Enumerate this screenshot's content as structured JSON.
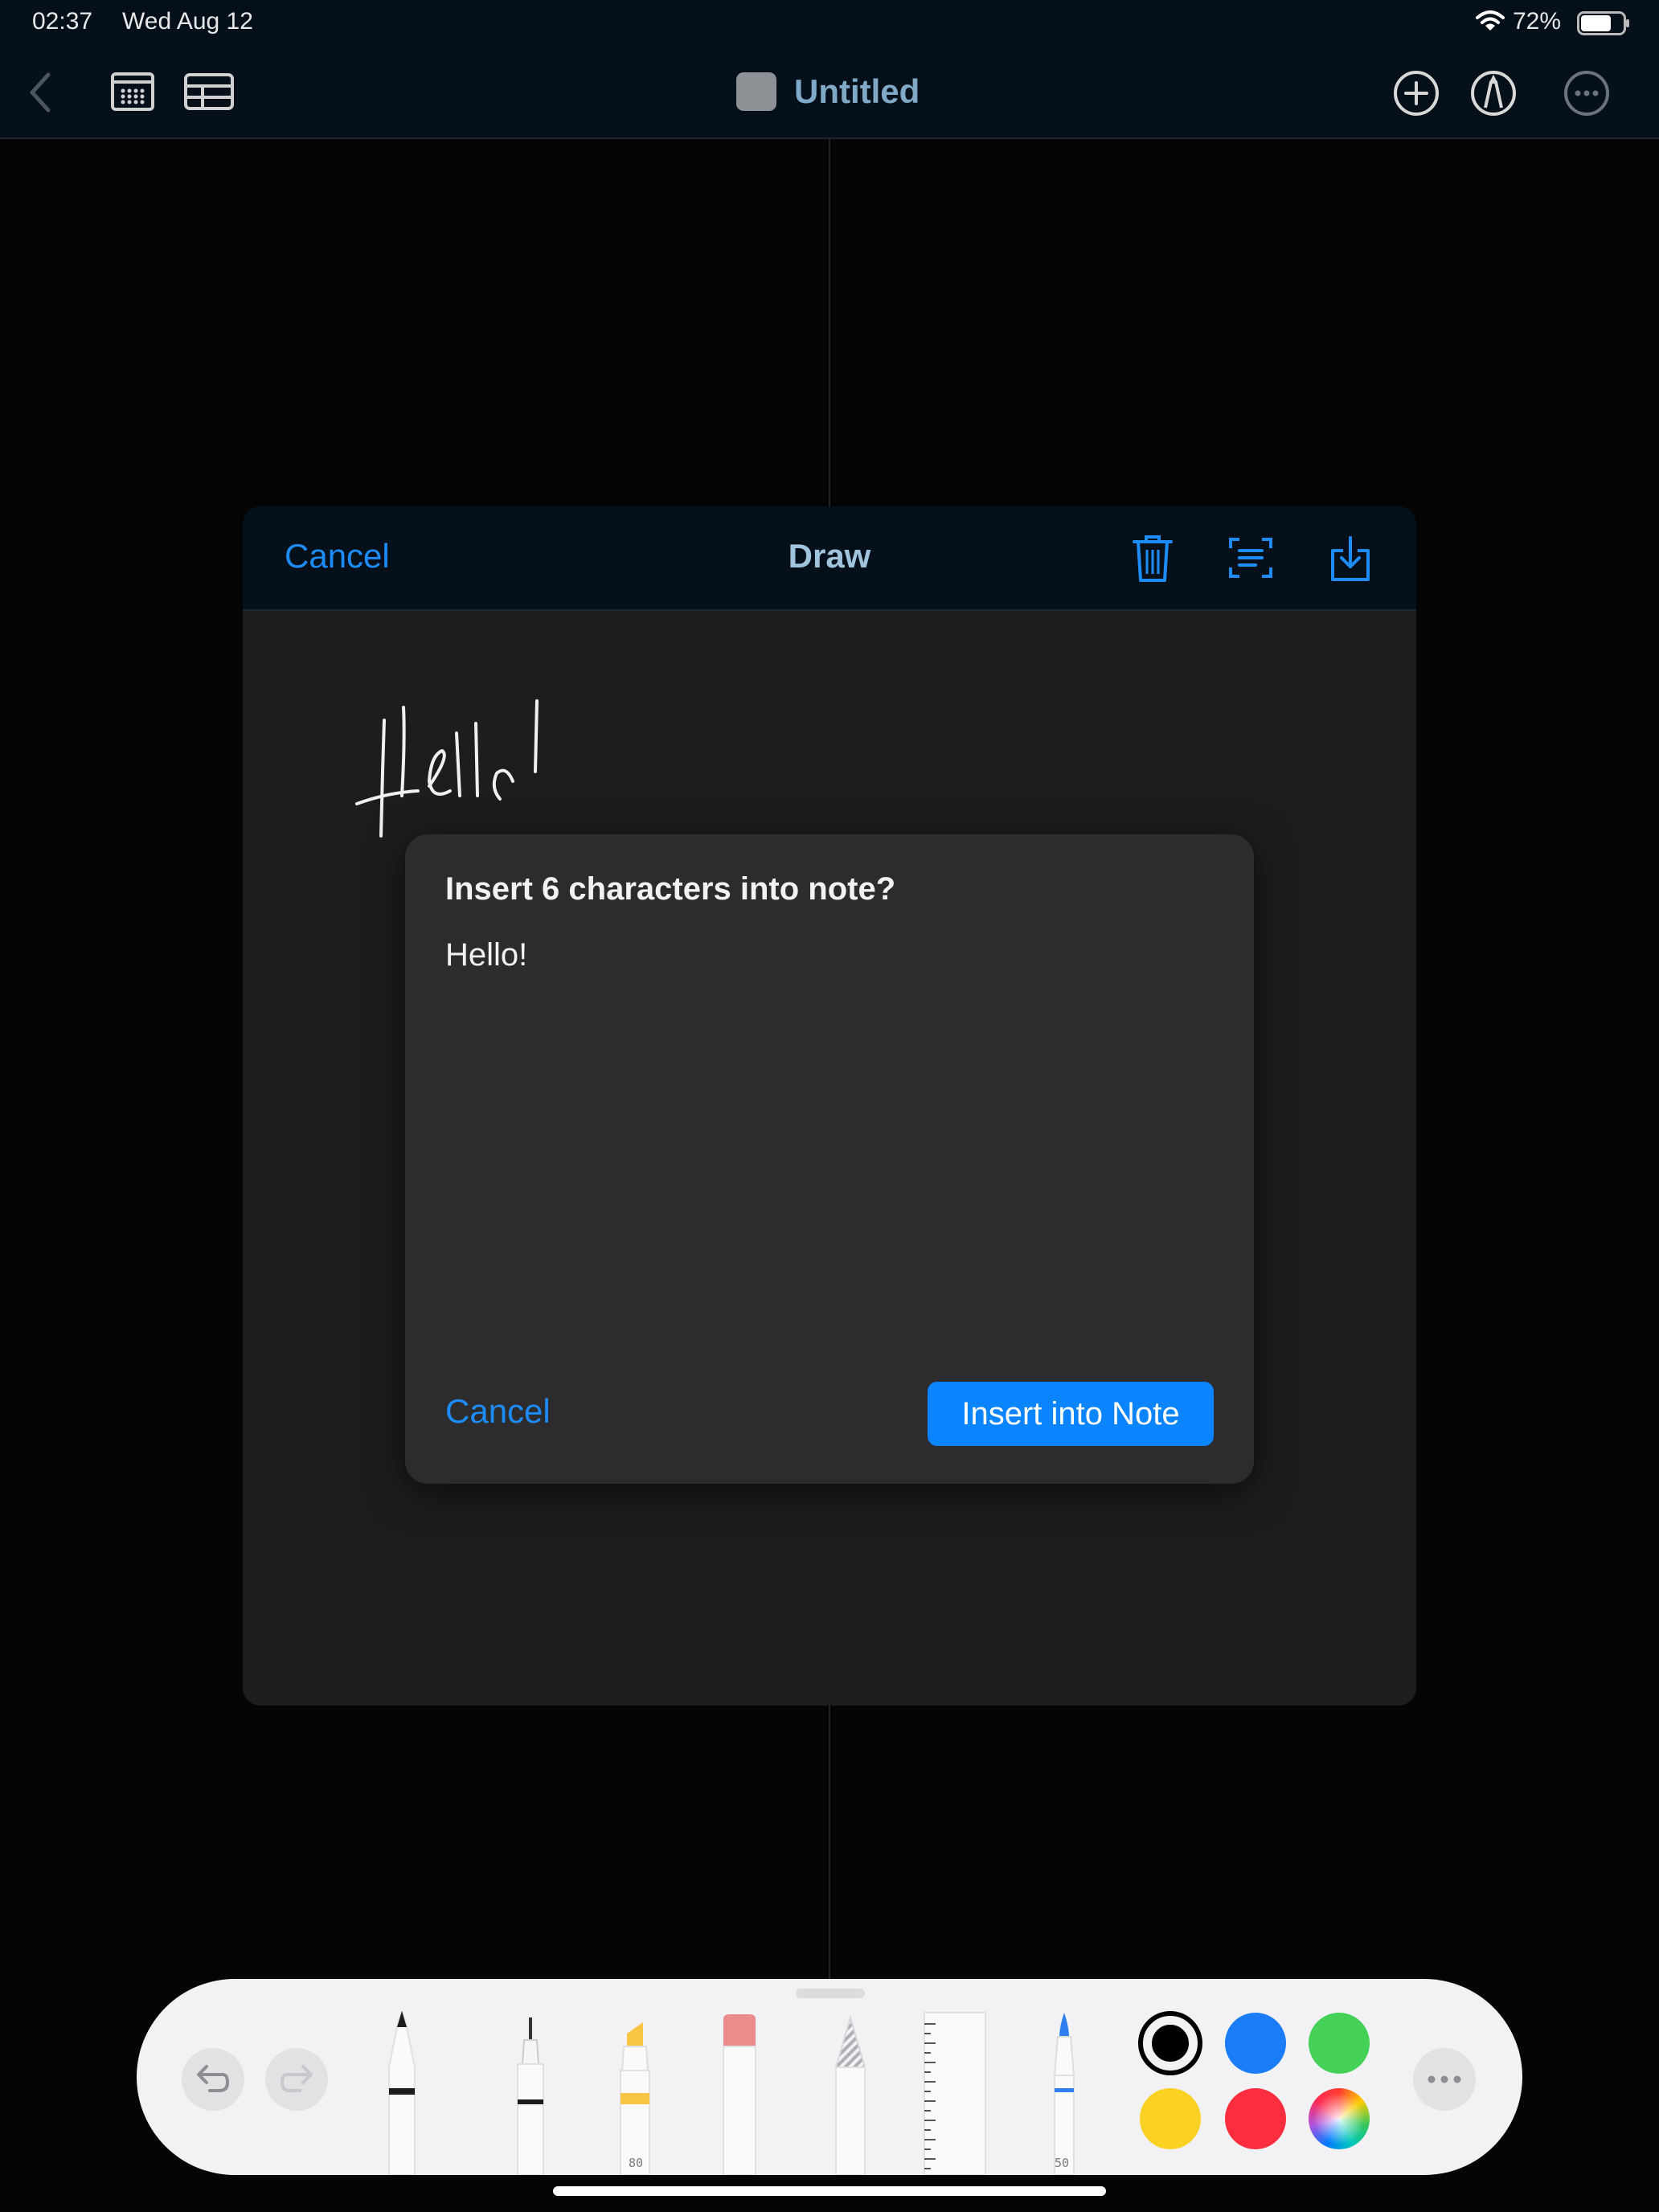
{
  "status_bar": {
    "time": "02:37",
    "date": "Wed Aug 12",
    "battery_percent": "72%",
    "battery_level": 0.72
  },
  "nav": {
    "title": "Untitled",
    "icons": [
      "chevron-left-icon",
      "gallery-icon",
      "table-icon",
      "plus-circle-icon",
      "markup-pen-icon",
      "ellipsis-circle-icon"
    ]
  },
  "draw_sheet": {
    "cancel_label": "Cancel",
    "title": "Draw",
    "icons": [
      "trash-icon",
      "scan-text-icon",
      "share-download-icon"
    ]
  },
  "alert": {
    "title": "Insert 6 characters into note?",
    "recognized_text": "Hello!",
    "cancel_label": "Cancel",
    "insert_label": "Insert into Note"
  },
  "palette": {
    "tools": [
      "pen",
      "fineliner",
      "marker",
      "eraser",
      "pencil",
      "ruler",
      "watercolor-brush"
    ],
    "marker_size": "80",
    "brush_size": "50",
    "colors": {
      "black": "#000000",
      "blue": "#1a7cf6",
      "green": "#45d157",
      "yellow": "#fdd024",
      "red": "#fc2d3e"
    },
    "selected_color": "black"
  },
  "theme": {
    "accent": "#1d8cf8",
    "button_blue": "#0b84ff"
  }
}
